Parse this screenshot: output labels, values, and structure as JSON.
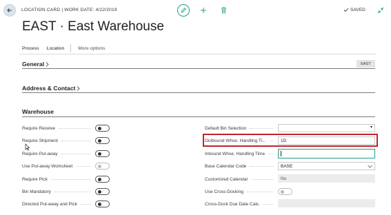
{
  "header": {
    "breadcrumb": "LOCATION CARD | WORK DATE: 4/22/2019",
    "saved_label": "SAVED"
  },
  "page_title": "EAST · East Warehouse",
  "menu": {
    "items": [
      "Process",
      "Location"
    ],
    "more": "More options"
  },
  "sections": {
    "general": {
      "label": "General",
      "badge": "EAST"
    },
    "address": {
      "label": "Address & Contact"
    },
    "warehouse": {
      "label": "Warehouse"
    }
  },
  "left_fields": [
    {
      "label": "Require Receive",
      "on": false,
      "enabled": true
    },
    {
      "label": "Require Shipment",
      "on": false,
      "enabled": true
    },
    {
      "label": "Require Put-away",
      "on": false,
      "enabled": true
    },
    {
      "label": "Use Put-away Worksheet",
      "on": false,
      "enabled": false
    },
    {
      "label": "Require Pick",
      "on": false,
      "enabled": true
    },
    {
      "label": "Bin Mandatory",
      "on": false,
      "enabled": true
    },
    {
      "label": "Directed Put-away and Pick",
      "on": false,
      "enabled": true
    }
  ],
  "right_fields": [
    {
      "label": "Default Bin Selection",
      "value": ""
    },
    {
      "label": "Outbound Whse. Handling Ti...",
      "value": "1D"
    },
    {
      "label": "Inbound Whse. Handling Time",
      "value": ""
    },
    {
      "label": "Base Calendar Code",
      "value": "BASE"
    },
    {
      "label": "Customized Calendar",
      "value": "No"
    },
    {
      "label": "Use Cross-Docking",
      "value": ""
    },
    {
      "label": "Cross-Dock Due Date Calc.",
      "value": ""
    }
  ],
  "colors": {
    "accent": "#1f9c8b",
    "highlight": "#c0202a"
  }
}
